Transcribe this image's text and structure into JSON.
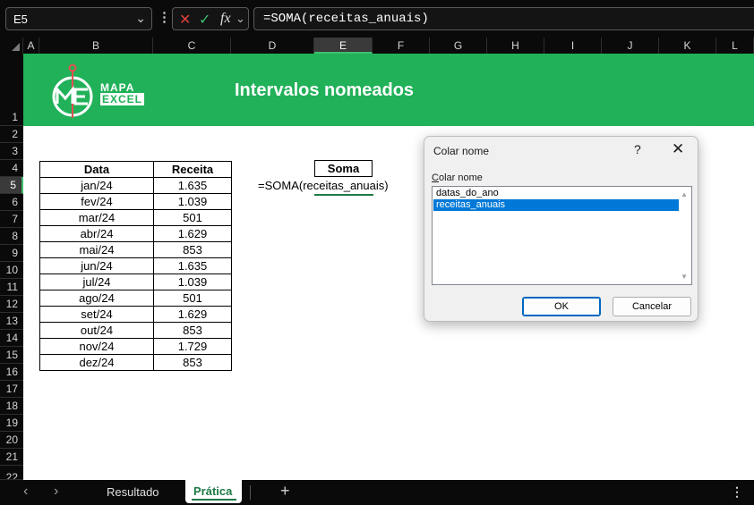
{
  "formula_bar": {
    "name_box": "E5",
    "formula": "=SOMA(receitas_anuais)",
    "icons": [
      "cancel-icon",
      "confirm-icon",
      "function-icon"
    ]
  },
  "columns": [
    "A",
    "B",
    "C",
    "D",
    "E",
    "F",
    "G",
    "H",
    "I",
    "J",
    "K",
    "L"
  ],
  "selected_column": "E",
  "rows": [
    "1",
    "2",
    "3",
    "4",
    "5",
    "6",
    "7",
    "8",
    "9",
    "10",
    "11",
    "12",
    "13",
    "14",
    "15",
    "16",
    "17",
    "18",
    "19",
    "20",
    "21",
    "22"
  ],
  "selected_row": "5",
  "banner": {
    "logo_line1": "MAPA",
    "logo_line2": "EXCEL",
    "title": "Intervalos nomeados",
    "color": "#21b159"
  },
  "table": {
    "headers": [
      "Data",
      "Receita"
    ],
    "rows": [
      [
        "jan/24",
        "1.635"
      ],
      [
        "fev/24",
        "1.039"
      ],
      [
        "mar/24",
        "501"
      ],
      [
        "abr/24",
        "1.629"
      ],
      [
        "mai/24",
        "853"
      ],
      [
        "jun/24",
        "1.635"
      ],
      [
        "jul/24",
        "1.039"
      ],
      [
        "ago/24",
        "501"
      ],
      [
        "set/24",
        "1.629"
      ],
      [
        "out/24",
        "853"
      ],
      [
        "nov/24",
        "1.729"
      ],
      [
        "dez/24",
        "853"
      ]
    ]
  },
  "soma": {
    "header": "Soma",
    "formula": "=SOMA(receitas_anuais)"
  },
  "dialog": {
    "title": "Colar nome",
    "help": "?",
    "close": "✕",
    "list_label_accel": "C",
    "list_label_rest": "olar nome",
    "items": [
      "datas_do_ano",
      "receitas_anuais"
    ],
    "selected_index": 1,
    "ok_label": "OK",
    "cancel_label": "Cancelar"
  },
  "sheet_tabs": {
    "tabs": [
      "Resultado",
      "Prática"
    ],
    "active": "Prática"
  },
  "colors": {
    "accent": "#1e7a45",
    "selection": "#0078d7"
  }
}
